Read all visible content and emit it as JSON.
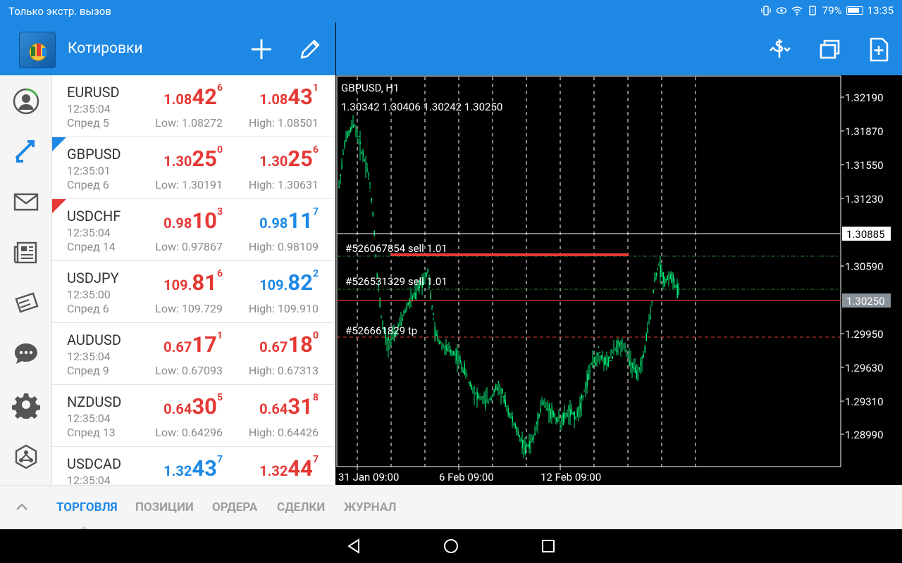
{
  "status_bar": {
    "carrier": "Только экстр. вызов",
    "battery": "79%",
    "time": "13:35"
  },
  "header": {
    "title": "Котировки"
  },
  "quotes": [
    {
      "symbol": "EURUSD",
      "time": "12:35:04",
      "spread": "Спред 5",
      "bid_pre": "1.08",
      "bid_big": "42",
      "bid_sup": "6",
      "bid_color": "red",
      "ask_pre": "1.08",
      "ask_big": "43",
      "ask_sup": "1",
      "ask_color": "red",
      "low": "Low: 1.08272",
      "high": "High: 1.08501",
      "marker": ""
    },
    {
      "symbol": "GBPUSD",
      "time": "12:35:01",
      "spread": "Спред 6",
      "bid_pre": "1.30",
      "bid_big": "25",
      "bid_sup": "0",
      "bid_color": "red",
      "ask_pre": "1.30",
      "ask_big": "25",
      "ask_sup": "6",
      "ask_color": "red",
      "low": "Low: 1.30191",
      "high": "High: 1.30631",
      "marker": "blue"
    },
    {
      "symbol": "USDCHF",
      "time": "12:35:04",
      "spread": "Спред 14",
      "bid_pre": "0.98",
      "bid_big": "10",
      "bid_sup": "3",
      "bid_color": "red",
      "ask_pre": "0.98",
      "ask_big": "11",
      "ask_sup": "7",
      "ask_color": "blue",
      "low": "Low: 0.97867",
      "high": "High: 0.98109",
      "marker": "red"
    },
    {
      "symbol": "USDJPY",
      "time": "12:35:00",
      "spread": "Спред 6",
      "bid_pre": "109.",
      "bid_big": "81",
      "bid_sup": "6",
      "bid_color": "red",
      "ask_pre": "109.",
      "ask_big": "82",
      "ask_sup": "2",
      "ask_color": "blue",
      "low": "Low: 109.729",
      "high": "High: 109.910",
      "marker": ""
    },
    {
      "symbol": "AUDUSD",
      "time": "12:35:04",
      "spread": "Спред 9",
      "bid_pre": "0.67",
      "bid_big": "17",
      "bid_sup": "1",
      "bid_color": "red",
      "ask_pre": "0.67",
      "ask_big": "18",
      "ask_sup": "0",
      "ask_color": "red",
      "low": "Low: 0.67093",
      "high": "High: 0.67313",
      "marker": ""
    },
    {
      "symbol": "NZDUSD",
      "time": "12:35:04",
      "spread": "Спред 13",
      "bid_pre": "0.64",
      "bid_big": "30",
      "bid_sup": "5",
      "bid_color": "red",
      "ask_pre": "0.64",
      "ask_big": "31",
      "ask_sup": "8",
      "ask_color": "red",
      "low": "Low: 0.64296",
      "high": "High: 0.64426",
      "marker": ""
    },
    {
      "symbol": "USDCAD",
      "time": "12:35:04",
      "spread": "",
      "bid_pre": "1.32",
      "bid_big": "43",
      "bid_sup": "7",
      "bid_color": "blue",
      "ask_pre": "1.32",
      "ask_big": "44",
      "ask_sup": "7",
      "ask_color": "red",
      "low": "",
      "high": "",
      "marker": ""
    }
  ],
  "chart": {
    "symbol_tf": "GBPUSD, H1",
    "ohlc": "1.30342 1.30406 1.30242 1.30250",
    "price_labels": [
      "1.32190",
      "1.31870",
      "1.31550",
      "1.31230",
      "1.30590",
      "1.29950",
      "1.29630",
      "1.29310",
      "1.28990"
    ],
    "crosshair_price": "1.30885",
    "current_price": "1.30250",
    "time_labels": [
      "31 Jan 09:00",
      "6 Feb 09:00",
      "12 Feb 09:00"
    ],
    "orders": [
      {
        "label": "#526067854 sell 1.01",
        "color": "#2e7d32"
      },
      {
        "label": "#526531329 sell 1.01",
        "color": "#2e7d32"
      },
      {
        "label": "#526661829 tp",
        "color": "#e53935"
      }
    ],
    "colors": {
      "bull": "#00e676",
      "grid": "#ffffff",
      "current": "#e53935",
      "sell_bar": "#e53935"
    }
  },
  "tabs": [
    {
      "label": "ТОРГОВЛЯ",
      "active": true
    },
    {
      "label": "ПОЗИЦИИ",
      "active": false
    },
    {
      "label": "ОРДЕРА",
      "active": false
    },
    {
      "label": "СДЕЛКИ",
      "active": false
    },
    {
      "label": "ЖУРНАЛ",
      "active": false
    }
  ]
}
